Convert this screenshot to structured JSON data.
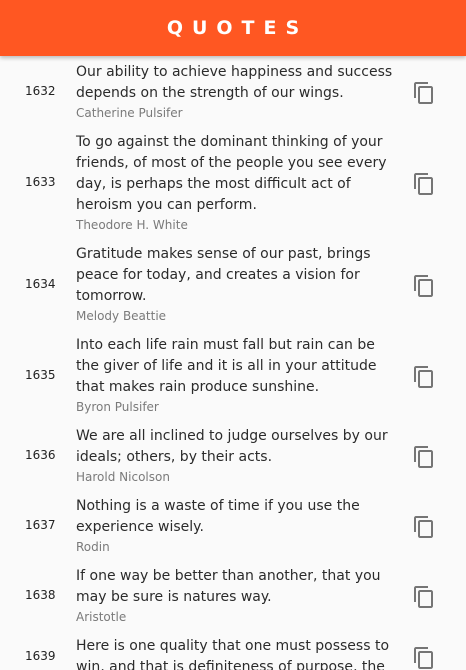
{
  "app_bar": {
    "title": "QUOTES"
  },
  "quotes": [
    {
      "number": "1632",
      "text": "Our ability to achieve happiness and success depends on the strength of our wings.",
      "author": "Catherine Pulsifer"
    },
    {
      "number": "1633",
      "text": "To go against the dominant thinking of your friends, of most of the people you see every day, is perhaps the most difficult act of heroism you can perform.",
      "author": "Theodore H. White"
    },
    {
      "number": "1634",
      "text": "Gratitude makes sense of our past, brings peace for today, and creates a vision for tomorrow.",
      "author": "Melody Beattie"
    },
    {
      "number": "1635",
      "text": "Into each life rain must fall but rain can be the giver of life and it is all in your attitude that makes rain produce sunshine.",
      "author": "Byron Pulsifer"
    },
    {
      "number": "1636",
      "text": "We are all inclined to judge ourselves by our ideals; others, by their acts.",
      "author": "Harold Nicolson"
    },
    {
      "number": "1637",
      "text": "Nothing is a waste of time if you use the experience wisely.",
      "author": "Rodin"
    },
    {
      "number": "1638",
      "text": "If one way be better than another, that you may be sure is natures way.",
      "author": "Aristotle"
    },
    {
      "number": "1639",
      "text": "Here is one quality that one must possess to win, and that is definiteness of purpose, the",
      "author": ""
    }
  ],
  "icons": {
    "copy": "copy-icon"
  },
  "colors": {
    "app_bar": "#ff5722",
    "background": "#fafafa",
    "icon": "#757575"
  }
}
